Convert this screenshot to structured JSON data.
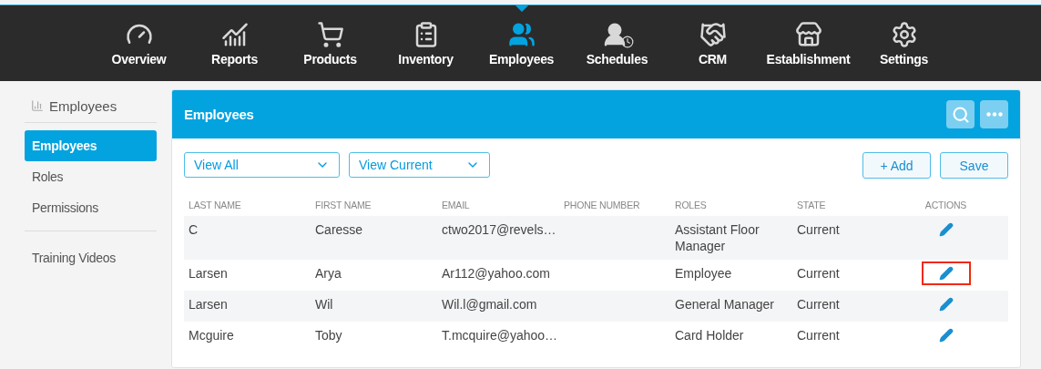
{
  "nav": [
    {
      "label": "Overview",
      "selected": false
    },
    {
      "label": "Reports",
      "selected": false
    },
    {
      "label": "Products",
      "selected": false
    },
    {
      "label": "Inventory",
      "selected": false
    },
    {
      "label": "Employees",
      "selected": true
    },
    {
      "label": "Schedules",
      "selected": false
    },
    {
      "label": "CRM",
      "selected": false
    },
    {
      "label": "Establishment",
      "selected": false
    },
    {
      "label": "Settings",
      "selected": false
    }
  ],
  "sidebar": {
    "title": "Employees",
    "groups": [
      [
        {
          "label": "Employees",
          "selected": true
        },
        {
          "label": "Roles",
          "selected": false
        },
        {
          "label": "Permissions",
          "selected": false
        }
      ],
      [
        {
          "label": "Training Videos",
          "selected": false
        }
      ]
    ]
  },
  "panel": {
    "title": "Employees",
    "filters": [
      "View All",
      "View Current"
    ],
    "buttons": [
      "+ Add",
      "Save"
    ],
    "table": {
      "columns": [
        "LAST NAME",
        "FIRST NAME",
        "EMAIL",
        "PHONE NUMBER",
        "ROLES",
        "STATE",
        "ACTIONS"
      ],
      "rows": [
        {
          "cells": [
            "C",
            "Caresse",
            "ctwo2017@revels…",
            "",
            "Assistant Floor Manager",
            "Current"
          ],
          "highlighted": false
        },
        {
          "cells": [
            "Larsen",
            "Arya",
            "Ar112@yahoo.com",
            "",
            "Employee",
            "Current"
          ],
          "highlighted": true
        },
        {
          "cells": [
            "Larsen",
            "Wil",
            "Wil.l@gmail.com",
            "",
            "General Manager",
            "Current"
          ],
          "highlighted": false
        },
        {
          "cells": [
            "Mcguire",
            "Toby",
            "T.mcquire@yahoo…",
            "",
            "Card Holder",
            "Current"
          ],
          "highlighted": false
        }
      ]
    }
  }
}
